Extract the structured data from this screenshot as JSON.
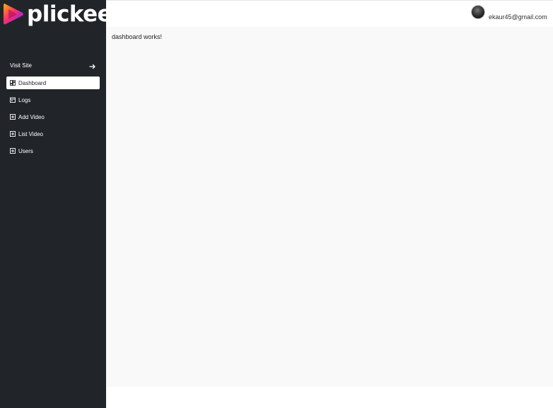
{
  "brand": {
    "name": "plickee",
    "logo_icon": "play-logo-icon"
  },
  "sidebar": {
    "visit_site": {
      "label": "Visit Site",
      "icon": "arrow-right-icon"
    },
    "items": [
      {
        "label": "Dashboard",
        "icon": "dashboard-icon",
        "active": true
      },
      {
        "label": "Logs",
        "icon": "calendar-icon",
        "active": false
      },
      {
        "label": "Add Video",
        "icon": "plus-box-icon",
        "active": false
      },
      {
        "label": "List Video",
        "icon": "plus-box-icon",
        "active": false
      },
      {
        "label": "Users",
        "icon": "plus-box-icon",
        "active": false
      }
    ]
  },
  "header": {
    "user_email": "ekaur45@gmail.com",
    "avatar_icon": "avatar"
  },
  "main": {
    "text": "dashboard works!"
  },
  "colors": {
    "sidebar_bg": "#212529",
    "main_bg": "#f9f9f9",
    "text": "#222222"
  }
}
